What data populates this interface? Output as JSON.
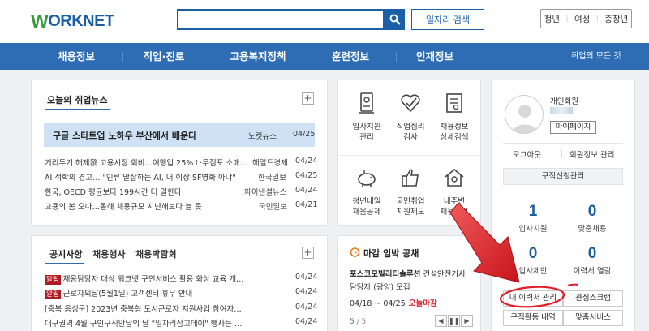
{
  "header": {
    "logo_w": "W",
    "logo_rest": "ORKNET",
    "search_placeholder": "",
    "job_search_label": "일자리 검색",
    "user_types": [
      "청년",
      "여성",
      "중장년"
    ],
    "separator": "|"
  },
  "nav": {
    "items": [
      "채용정보",
      "직업·진로",
      "고용복지정책",
      "훈련정보",
      "인재정보"
    ],
    "all_label": "취업의 모든 것"
  },
  "news": {
    "title": "오늘의 취업뉴스",
    "plus": "+",
    "featured": {
      "title": "구글 스타트업 노하우 부산에서 배운다",
      "source": "노컷뉴스",
      "date": "04/25"
    },
    "items": [
      {
        "title": "거리두기 해제發 고용시장 회비…여행업 25%↑·무점포 소매…",
        "source": "헤럴드경제",
        "date": "04/24"
      },
      {
        "title": "AI 석학의 경고… \"인류 말살하는 AI, 더 이상 SF영화 아냐\"",
        "source": "한국일보",
        "date": "04/25"
      },
      {
        "title": "한국, OECD 평균보다 199시간 더 일한다",
        "source": "파이낸셜뉴스",
        "date": "04/24"
      },
      {
        "title": "고용의 봄 오나…올해 채용규모 지난해보다 늘 듯",
        "source": "국민일보",
        "date": "04/21"
      }
    ]
  },
  "notice": {
    "tabs": [
      "공지사항",
      "채용행사",
      "채용박람회"
    ],
    "plus": "+",
    "items": [
      {
        "badge": "알림",
        "title": "채용담당자 대상 워크넷 구인서비스 활용 화상 교육 개…",
        "date": "04/24"
      },
      {
        "badge": "알림",
        "title": "근로자의날(5월1일) 고객센터 휴무 안내",
        "date": "04/24"
      },
      {
        "badge": "",
        "title": "[충북 음성군] 2023년 충북형 도시근로자 지원사업 참여자…",
        "date": "04/24"
      },
      {
        "badge": "",
        "title": "대구권역 4월 구인구직만남의 날 \"일자리잡고데이\" 행사는 …",
        "date": "04/24"
      }
    ]
  },
  "services": [
    {
      "line1": "입사지원",
      "line2": "관리",
      "icon": "id-card-icon"
    },
    {
      "line1": "직업심리",
      "line2": "검사",
      "icon": "heart-check-icon"
    },
    {
      "line1": "채용정보",
      "line2": "상세검색",
      "icon": "document-search-icon"
    },
    {
      "line1": "청년내일",
      "line2": "채움공제",
      "icon": "piggy-bank-icon"
    },
    {
      "line1": "국민취업",
      "line2": "지원제도",
      "icon": "thumbs-up-icon"
    },
    {
      "line1": "내주변",
      "line2": "채용정보",
      "icon": "home-location-icon"
    }
  ],
  "deadline": {
    "title": "마감 임박 공채",
    "company": "포스코모빌리티솔루션",
    "company_suffix": "건설안전기사",
    "job": "담당자 (광양) 모집",
    "period": "04/18 ~ 04/25",
    "flag": "오늘마감",
    "page_current": "5",
    "page_total": " / 5",
    "prev": "◀",
    "pause": "❚❚",
    "next": "▶"
  },
  "user": {
    "member_type": "개인회원",
    "mypage": "마이페이지",
    "logout": "로그아웃",
    "edit_info": "회원정보 관리",
    "mgmt": "구직신청관리",
    "stats": [
      {
        "num": "1",
        "label": "입사지원"
      },
      {
        "num": "0",
        "label": "맞춤채용"
      },
      {
        "num": "0",
        "label": "입사제안"
      },
      {
        "num": "0",
        "label": "이력서 열람"
      }
    ],
    "buttons": [
      "내 이력서 관리",
      "관심스크랩",
      "구직활동 내역",
      "맞춤서비스"
    ]
  },
  "colors": {
    "brand_blue": "#2e6db4",
    "brand_green": "#3a9a3e",
    "accent_red": "#d4262e"
  }
}
